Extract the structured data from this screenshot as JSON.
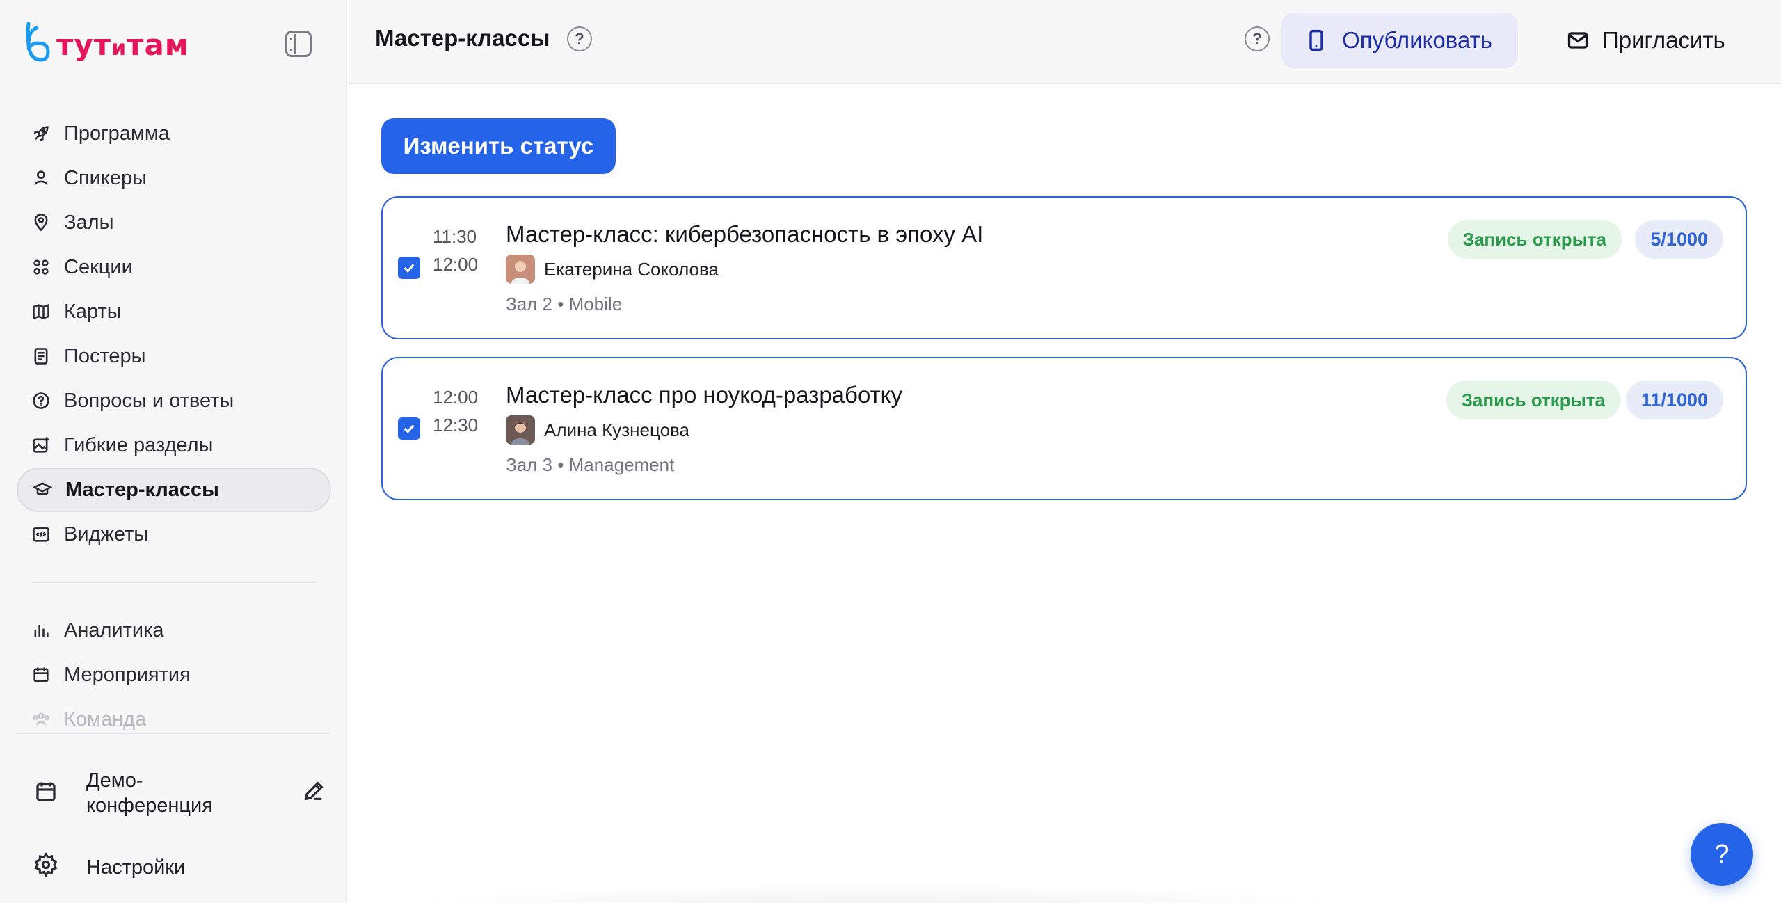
{
  "brand": {
    "logo_text_1": "тут",
    "logo_text_2": "и",
    "logo_text_3": "там",
    "color": "#e5175a"
  },
  "sidebar": {
    "items": [
      {
        "label": "Программа",
        "icon": "rocket-icon"
      },
      {
        "label": "Спикеры",
        "icon": "user-icon"
      },
      {
        "label": "Залы",
        "icon": "map-pin-icon"
      },
      {
        "label": "Секции",
        "icon": "grid-dots-icon"
      },
      {
        "label": "Карты",
        "icon": "map-icon"
      },
      {
        "label": "Постеры",
        "icon": "poster-icon"
      },
      {
        "label": "Вопросы и ответы",
        "icon": "question-circle-icon"
      },
      {
        "label": "Гибкие разделы",
        "icon": "image-plus-icon"
      },
      {
        "label": "Мастер-классы",
        "icon": "graduation-cap-icon",
        "active": true
      },
      {
        "label": "Виджеты",
        "icon": "code-icon"
      }
    ],
    "secondary_items": [
      {
        "label": "Аналитика",
        "icon": "bar-chart-icon"
      },
      {
        "label": "Мероприятия",
        "icon": "calendar-icon"
      },
      {
        "label": "Команда",
        "icon": "team-icon"
      }
    ],
    "event_name": "Демо-конференция",
    "settings_label": "Настройки"
  },
  "header": {
    "title": "Мастер-классы",
    "help_mark": "?",
    "publish_label": "Опубликовать",
    "invite_label": "Пригласить"
  },
  "main": {
    "change_status_label": "Изменить статус",
    "cards": [
      {
        "checked": true,
        "start": "11:30",
        "end": "12:00",
        "title": "Мастер-класс: кибербезопасность в эпоху AI",
        "speaker": "Екатерина Соколова",
        "meta": "Зал 2 • Mobile",
        "status": "Запись открыта",
        "count": "5/1000"
      },
      {
        "checked": true,
        "start": "12:00",
        "end": "12:30",
        "title": "Мастер-класс про ноукод-разработку",
        "speaker": "Алина Кузнецова",
        "meta": "Зал 3 • Management",
        "status": "Запись открыта",
        "count": "11/1000"
      }
    ]
  },
  "fab": {
    "label": "?"
  },
  "colors": {
    "accent": "#2563e8",
    "status_green": "#2c9a4c",
    "status_green_bg": "#e5f6e9",
    "count_bg": "#e8ecf9"
  }
}
